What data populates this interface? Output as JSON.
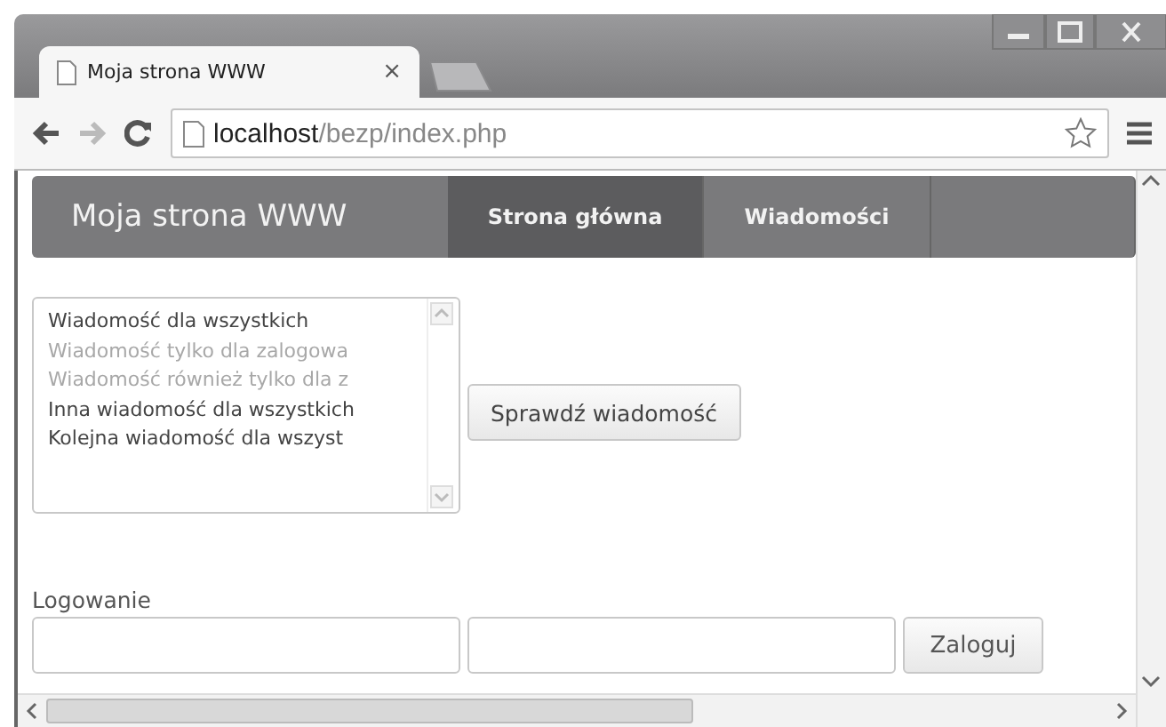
{
  "window": {
    "tab_title": "Moja strona WWW",
    "tab_close": "×"
  },
  "address_bar": {
    "host": "localhost",
    "path": "/bezp/index.php"
  },
  "nav": {
    "brand": "Moja strona WWW",
    "items": [
      {
        "label": "Strona główna",
        "selected": true
      },
      {
        "label": "Wiadomości",
        "selected": false
      }
    ]
  },
  "messages": {
    "items": [
      {
        "text": "Wiadomość dla wszystkich",
        "disabled": false
      },
      {
        "text": "Wiadomość tylko dla zalogowa",
        "disabled": true
      },
      {
        "text": "Wiadomość również tylko dla z",
        "disabled": true
      },
      {
        "text": "Inna wiadomość dla wszystkich",
        "disabled": false
      },
      {
        "text": "Kolejna wiadomość dla wszyst",
        "disabled": false
      }
    ],
    "button": "Sprawdź wiadomość"
  },
  "login": {
    "heading": "Logowanie",
    "button": "Zaloguj"
  }
}
